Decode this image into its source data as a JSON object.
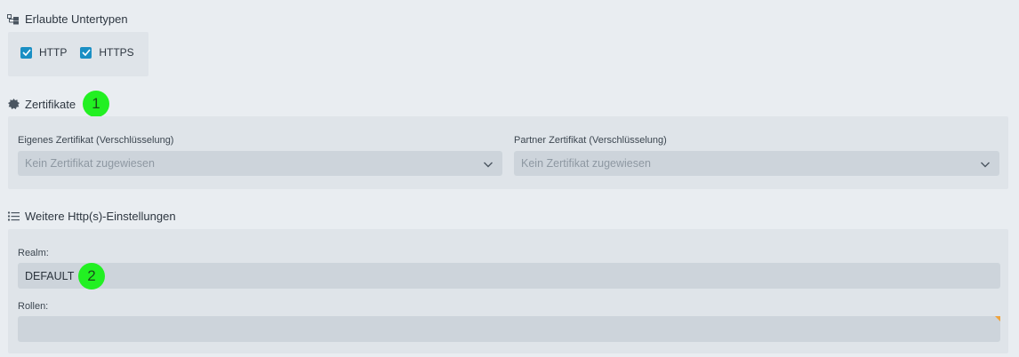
{
  "subtypes": {
    "title": "Erlaubte Untertypen",
    "icon": "hierarchy-icon",
    "options": [
      {
        "label": "HTTP",
        "checked": true
      },
      {
        "label": "HTTPS",
        "checked": true
      }
    ]
  },
  "certificates": {
    "title": "Zertifikate",
    "icon": "certificate-icon",
    "marker": "1",
    "own": {
      "label": "Eigenes Zertifikat (Verschlüsselung)",
      "placeholder": "Kein Zertifikat zugewiesen"
    },
    "partner": {
      "label": "Partner Zertifikat (Verschlüsselung)",
      "placeholder": "Kein Zertifikat zugewiesen"
    }
  },
  "http_settings": {
    "title": "Weitere Http(s)-Einstellungen",
    "icon": "list-icon",
    "realm": {
      "label": "Realm:",
      "value": "DEFAULT",
      "marker": "2"
    },
    "roles": {
      "label": "Rollen:",
      "value": ""
    }
  },
  "colors": {
    "checkbox": "#1a8fc4",
    "marker": "#22f022",
    "required_flag": "#f0a33c"
  }
}
